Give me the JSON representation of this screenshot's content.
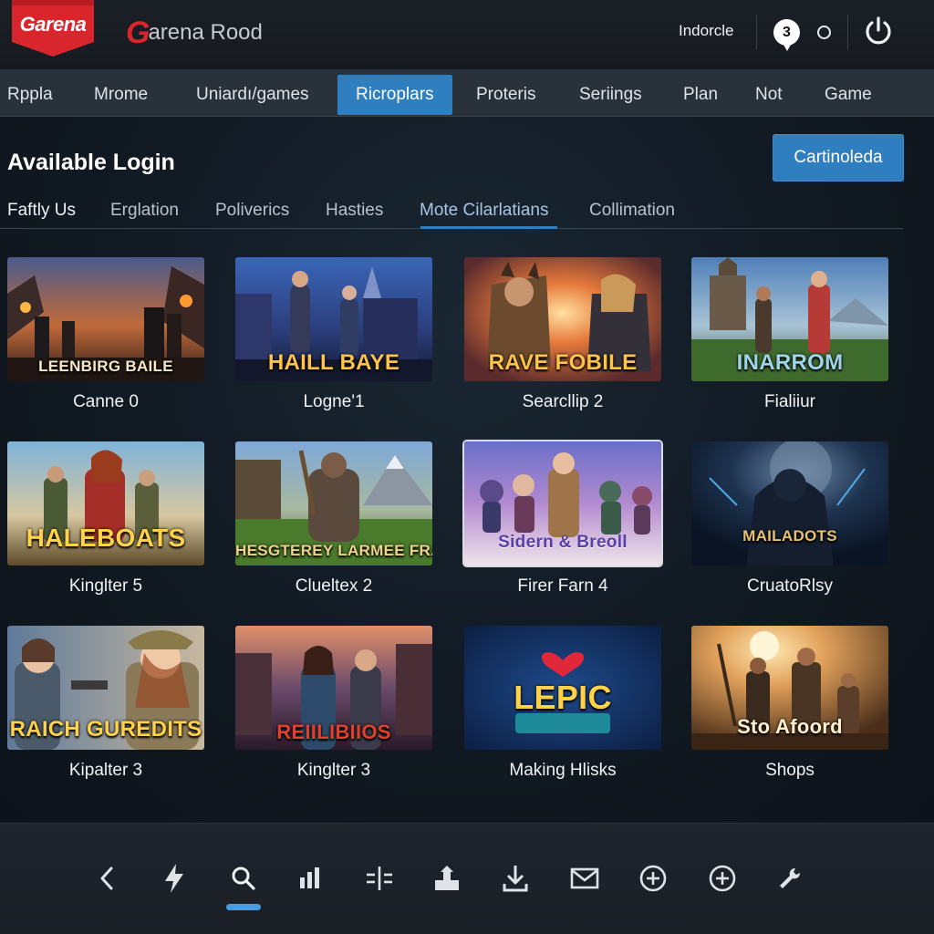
{
  "header": {
    "logo_text": "Garena",
    "brand": "arena Rood",
    "brand_mark": "G",
    "user_label": "Indorcle",
    "notification_count": "3"
  },
  "nav": {
    "items": [
      {
        "label": "Rppla"
      },
      {
        "label": "Mrome"
      },
      {
        "label": "Uniardı/games"
      },
      {
        "label": "Ricroplars",
        "active": true
      },
      {
        "label": "Proteris"
      },
      {
        "label": "Seriings"
      },
      {
        "label": "Plan"
      },
      {
        "label": "Not"
      },
      {
        "label": "Game"
      }
    ]
  },
  "main": {
    "title": "Available Login",
    "primary_button": "Cartinoleda",
    "subtabs": [
      {
        "label": "Faftly Us"
      },
      {
        "label": "Erglation"
      },
      {
        "label": "Poliverics"
      },
      {
        "label": "Hasties"
      },
      {
        "label": "Mote Cilarlatians",
        "active": true
      },
      {
        "label": "Collimation"
      }
    ]
  },
  "games": [
    {
      "label": "Canne 0",
      "art_title": "LEENBIRG BAILE"
    },
    {
      "label": "Logne'1",
      "art_title": "HAILL BAYE"
    },
    {
      "label": "Searcllip 2",
      "art_title": "RAVE FOBILE"
    },
    {
      "label": "Fialiiur",
      "art_title": "INARROM"
    },
    {
      "label": "Kinglter 5",
      "art_title": "HALEBOATS"
    },
    {
      "label": "Clueltex 2",
      "art_title": "HESGTEREY LARMEE FRANOS"
    },
    {
      "label": "Firer Farn 4",
      "art_title": "Sidern & Breoll"
    },
    {
      "label": "CruatoRlsy",
      "art_title": "MAILADOTS"
    },
    {
      "label": "Kipalter 3",
      "art_title": "RAICH GUREDITS"
    },
    {
      "label": "Kinglter 3",
      "art_title": "REIILIBIIOS"
    },
    {
      "label": "Making Hlisks",
      "art_title": "LEPIC"
    },
    {
      "label": "Shops",
      "art_title": "Sto Afoord"
    }
  ],
  "toolbar": {
    "icons": [
      "back-icon",
      "lightning-icon",
      "search-icon",
      "stats-icon",
      "split-icon",
      "upload-icon",
      "download-icon",
      "mail-icon",
      "add-circle-icon",
      "add-circle-icon",
      "wrench-icon"
    ],
    "active_index": 2
  },
  "colors": {
    "accent": "#2f7ebf",
    "brand_red": "#d9262c",
    "background": "#0f151d",
    "nav_bar": "#29313b"
  }
}
